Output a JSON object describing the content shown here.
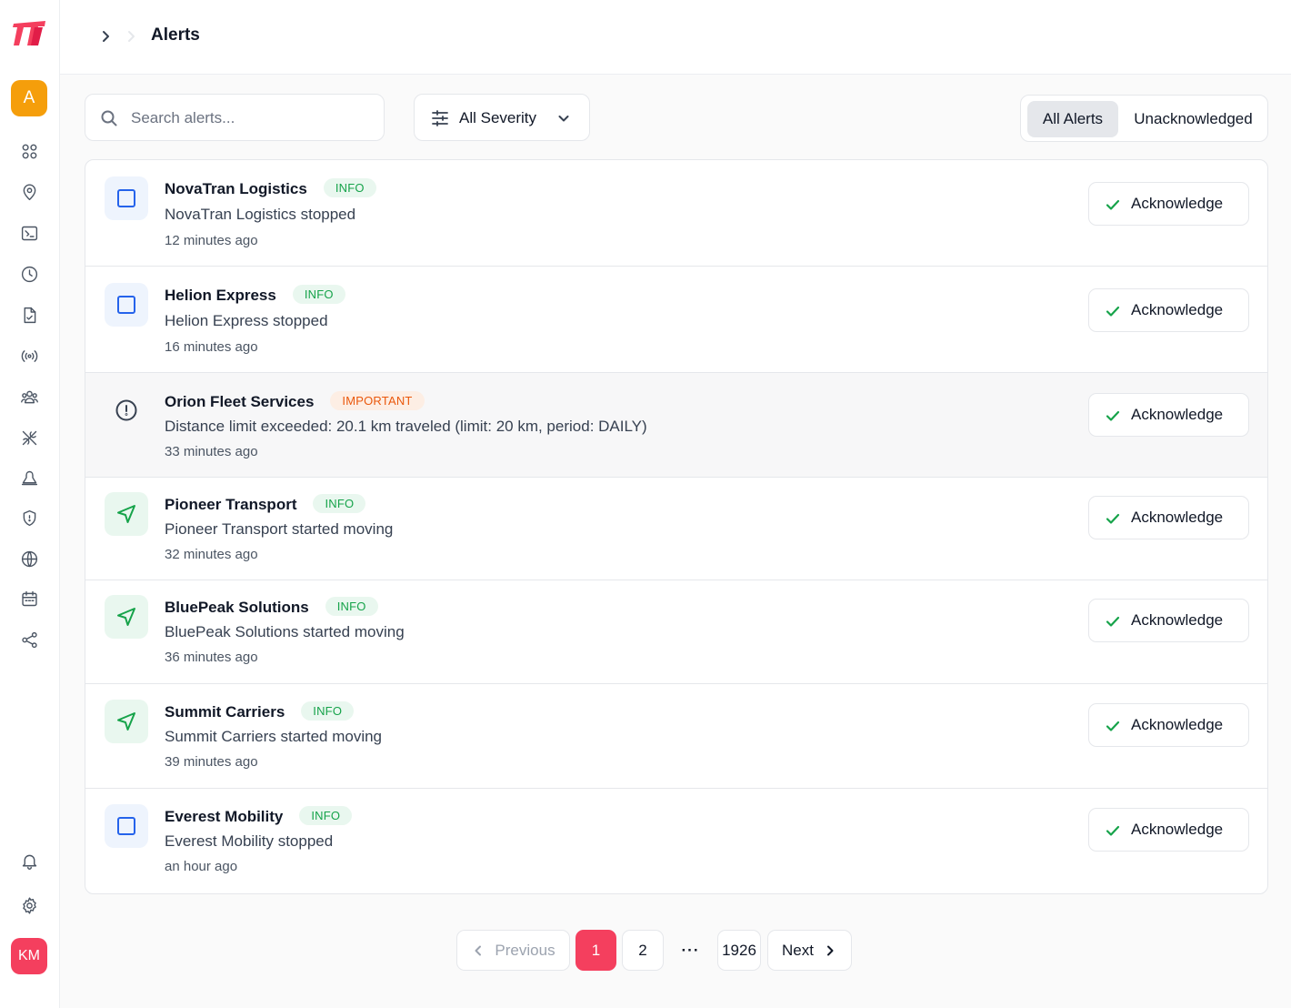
{
  "sidebar": {
    "workspace_initial": "A",
    "user_initials": "KM",
    "brand_color": "#f43f5e",
    "nav": [
      {
        "icon": "dashboard-grid-icon"
      },
      {
        "icon": "map-pin-icon"
      },
      {
        "icon": "image-icon"
      },
      {
        "icon": "clock-icon"
      },
      {
        "icon": "report-file-icon"
      },
      {
        "icon": "broadcast-icon"
      },
      {
        "icon": "users-icon"
      },
      {
        "icon": "tools-icon"
      },
      {
        "icon": "alert-bell-shape-icon"
      },
      {
        "icon": "shield-icon"
      },
      {
        "icon": "globe-icon"
      },
      {
        "icon": "calendar-icon"
      },
      {
        "icon": "share-icon"
      }
    ],
    "bottom": [
      {
        "icon": "bell-icon"
      },
      {
        "icon": "gear-icon"
      }
    ]
  },
  "header": {
    "title": "Alerts"
  },
  "toolbar": {
    "search_placeholder": "Search alerts...",
    "severity_label": "All Severity",
    "tabs": [
      "All Alerts",
      "Unacknowledged"
    ],
    "active_tab": "All Alerts"
  },
  "alerts": [
    {
      "name": "NovaTran Logistics",
      "severity": "INFO",
      "message": "NovaTran Logistics stopped",
      "time": "12 minutes ago",
      "icon": "square-stop-icon",
      "action": "Acknowledge"
    },
    {
      "name": "Helion Express",
      "severity": "INFO",
      "message": "Helion Express stopped",
      "time": "16 minutes ago",
      "icon": "square-stop-icon",
      "action": "Acknowledge"
    },
    {
      "name": "Orion Fleet Services",
      "severity": "IMPORTANT",
      "message": "Distance limit exceeded: 20.1 km traveled (limit: 20 km, period: DAILY)",
      "time": "33 minutes ago",
      "icon": "alert-circle-icon",
      "action": "Acknowledge"
    },
    {
      "name": "Pioneer Transport",
      "severity": "INFO",
      "message": "Pioneer Transport started moving",
      "time": "32 minutes ago",
      "icon": "navigation-arrow-icon",
      "action": "Acknowledge"
    },
    {
      "name": "BluePeak Solutions",
      "severity": "INFO",
      "message": "BluePeak Solutions started moving",
      "time": "36 minutes ago",
      "icon": "navigation-arrow-icon",
      "action": "Acknowledge"
    },
    {
      "name": "Summit Carriers",
      "severity": "INFO",
      "message": "Summit Carriers started moving",
      "time": "39 minutes ago",
      "icon": "navigation-arrow-icon",
      "action": "Acknowledge"
    },
    {
      "name": "Everest Mobility",
      "severity": "INFO",
      "message": "Everest Mobility stopped",
      "time": "an hour ago",
      "icon": "square-stop-icon",
      "action": "Acknowledge"
    }
  ],
  "pagination": {
    "previous": "Previous",
    "pages": [
      "1",
      "2"
    ],
    "ellipsis": "···",
    "last_page": "1926",
    "next": "Next",
    "current": "1"
  },
  "colors": {
    "info_text": "#16a34a",
    "info_bg": "#e9f7ef",
    "important_text": "#ea580c",
    "important_bg": "#fdeee4",
    "stop_icon": "#2563eb",
    "active_page": "#f43f5e",
    "workspace_avatar": "#f59e0b"
  }
}
